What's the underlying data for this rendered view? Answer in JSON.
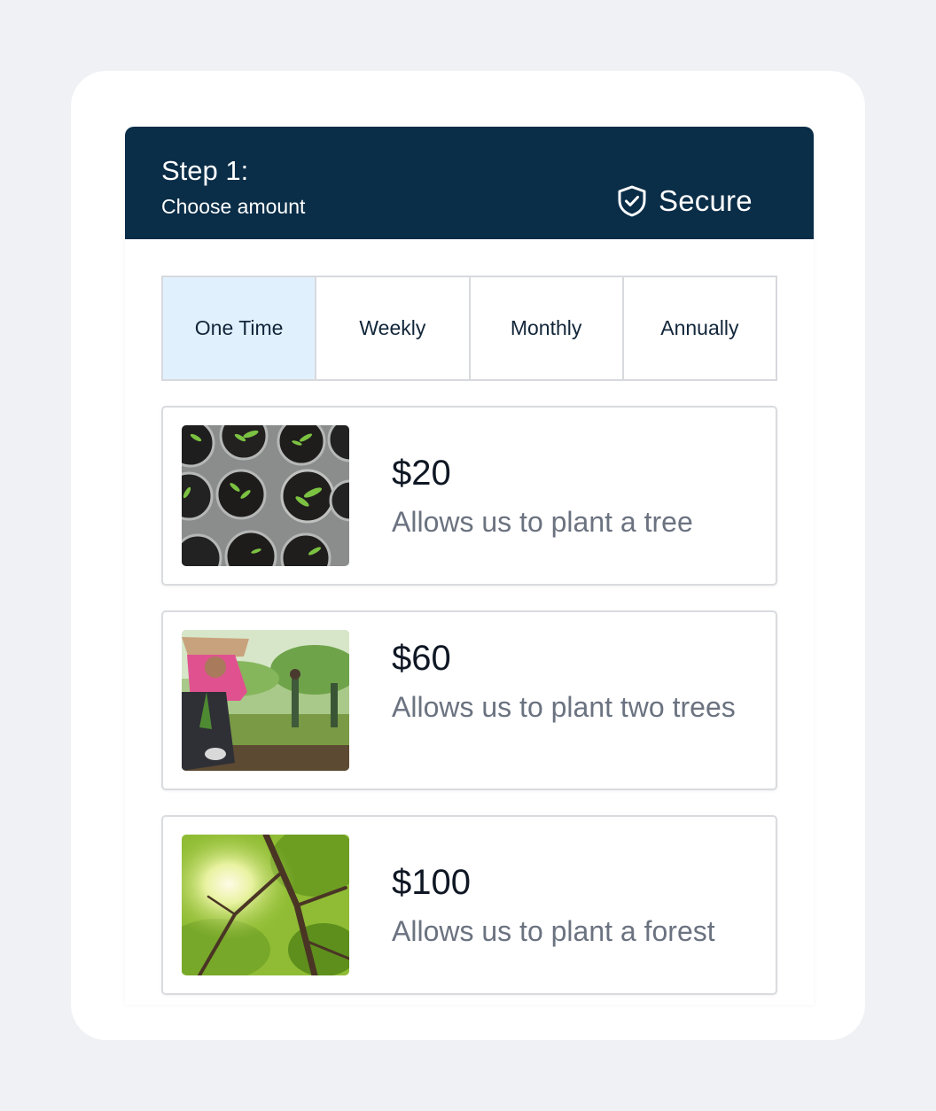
{
  "header": {
    "step_title": "Step 1:",
    "step_subtitle": "Choose amount",
    "secure_label": "Secure",
    "secure_icon": "shield-check-icon",
    "background_color": "#0a2d48"
  },
  "frequency_tabs": [
    {
      "label": "One Time",
      "selected": true
    },
    {
      "label": "Weekly",
      "selected": false
    },
    {
      "label": "Monthly",
      "selected": false
    },
    {
      "label": "Annually",
      "selected": false
    }
  ],
  "donation_options": [
    {
      "amount": "$20",
      "description": "Allows us to plant a tree",
      "image": "seedlings-in-pots-photo"
    },
    {
      "amount": "$60",
      "description": "Allows us to plant two trees",
      "image": "person-planting-sapling-photo"
    },
    {
      "amount": "$100",
      "description": "Allows us to plant a forest",
      "image": "forest-canopy-photo"
    }
  ],
  "colors": {
    "selected_tab": "#e1f0fd",
    "page_background": "#eff1f5"
  }
}
